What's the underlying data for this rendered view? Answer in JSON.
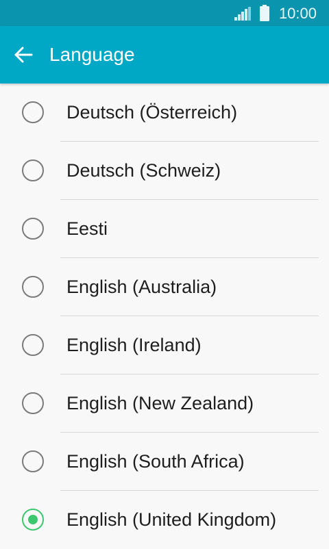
{
  "status_bar": {
    "time": "10:00",
    "signal_icon": "cell-signal-icon",
    "battery_icon": "battery-icon"
  },
  "app_bar": {
    "title": "Language",
    "back_icon": "arrow-back-icon",
    "color": "#00a8c6"
  },
  "languages": [
    {
      "label": "Deutsch (Österreich)",
      "selected": false
    },
    {
      "label": "Deutsch (Schweiz)",
      "selected": false
    },
    {
      "label": "Eesti",
      "selected": false
    },
    {
      "label": "English (Australia)",
      "selected": false
    },
    {
      "label": "English (Ireland)",
      "selected": false
    },
    {
      "label": "English (New Zealand)",
      "selected": false
    },
    {
      "label": "English (South Africa)",
      "selected": false
    },
    {
      "label": "English (United Kingdom)",
      "selected": true
    }
  ],
  "colors": {
    "status_bar": "#0b94ad",
    "accent": "#00a8c6",
    "selected_radio": "#3cc76e",
    "unselected_radio": "#7a7a7a"
  }
}
